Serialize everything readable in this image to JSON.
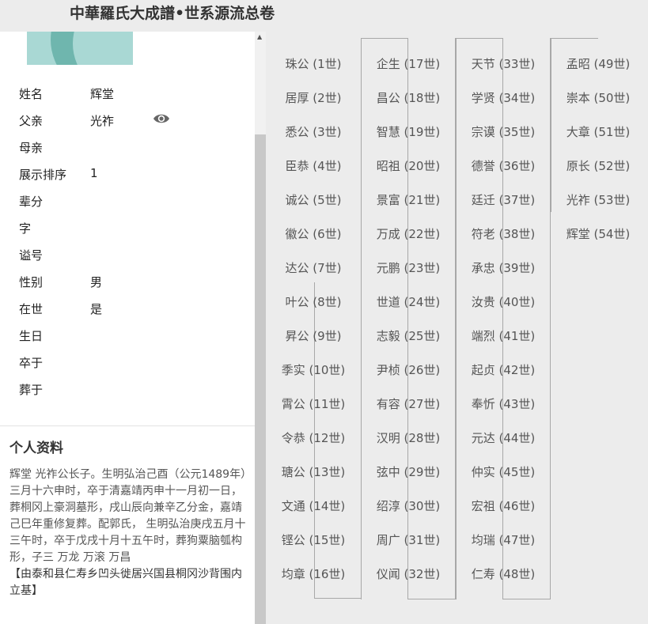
{
  "header": {
    "title": "中華羅氏大成譜•世系源流总卷"
  },
  "profile": {
    "fields": [
      {
        "label": "姓名",
        "value": "辉堂"
      },
      {
        "label": "父亲",
        "value": "光祚"
      },
      {
        "label": "母亲",
        "value": ""
      },
      {
        "label": "展示排序",
        "value": "1"
      },
      {
        "label": "辈分",
        "value": ""
      },
      {
        "label": "字",
        "value": ""
      },
      {
        "label": "谥号",
        "value": ""
      },
      {
        "label": "性别",
        "value": "男"
      },
      {
        "label": "在世",
        "value": "是"
      },
      {
        "label": "生日",
        "value": ""
      },
      {
        "label": "卒于",
        "value": ""
      },
      {
        "label": "葬于",
        "value": ""
      }
    ]
  },
  "bio": {
    "heading": "个人资料",
    "text": "辉堂  光祚公长子。生明弘治己酉（公元1489年）三月十六申时，卒于清嘉靖丙申十一月初一日， 葬桐冈上豪洞墓形，戌山辰向兼辛乙分金，嘉靖己巳年重修复葬。配郭氏， 生明弘治庚戌五月十三午时，卒于戊戌十月十五午时，葬狗粟脑瓠构形，子三  万龙  万滚  万昌",
    "note": "【由泰和县仁寿乡凹头徙居兴国县桐冈沙背围内立基】"
  },
  "lineage": {
    "columns": [
      [
        "珠公 (1世)",
        "居厚 (2世)",
        "悉公 (3世)",
        "臣恭 (4世)",
        "诚公 (5世)",
        "徽公 (6世)",
        "达公 (7世)",
        "叶公 (8世)",
        "昇公 (9世)",
        "季实 (10世)",
        "霄公 (11世)",
        "令恭 (12世)",
        "瑭公 (13世)",
        "文通 (14世)",
        "铿公 (15世)",
        "均章 (16世)"
      ],
      [
        "企生 (17世)",
        "昌公 (18世)",
        "智慧 (19世)",
        "昭祖 (20世)",
        "景富 (21世)",
        "万成 (22世)",
        "元鹏 (23世)",
        "世道 (24世)",
        "志毅 (25世)",
        "尹桢 (26世)",
        "有容 (27世)",
        "汉明 (28世)",
        "弦中 (29世)",
        "绍淳 (30世)",
        "周广 (31世)",
        "仪闻 (32世)"
      ],
      [
        "天节 (33世)",
        "学贤 (34世)",
        "宗谟 (35世)",
        "德誉 (36世)",
        "廷迁 (37世)",
        "符老 (38世)",
        "承忠 (39世)",
        "汝贵 (40世)",
        "端烈 (41世)",
        "起贞 (42世)",
        "奉忻 (43世)",
        "元达 (44世)",
        "仲实 (45世)",
        "宏祖 (46世)",
        "均瑞 (47世)",
        "仁寿 (48世)"
      ],
      [
        "孟昭 (49世)",
        "崇本 (50世)",
        "大章 (51世)",
        "原长 (52世)",
        "光祚 (53世)",
        "辉堂 (54世)"
      ]
    ]
  },
  "icons": {
    "eye": "eye-icon",
    "scroll_up": "scroll-up-arrow-icon"
  }
}
